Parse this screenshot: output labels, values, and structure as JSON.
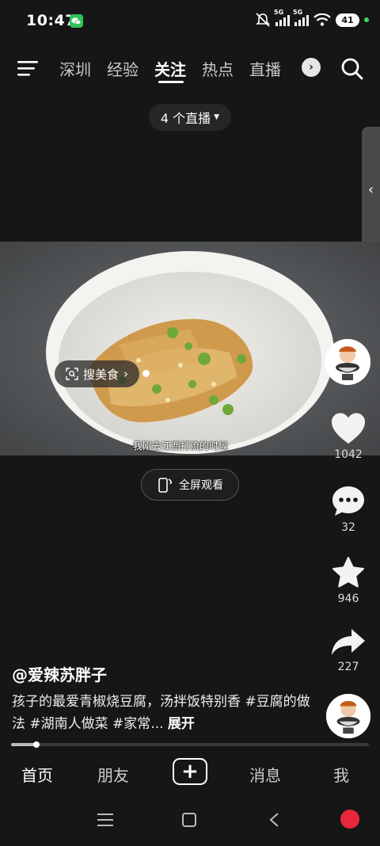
{
  "status_bar": {
    "time": "10:47",
    "signal_1": "5G",
    "signal_2": "5G",
    "battery": "41",
    "icons": [
      "wechat-icon",
      "mute-icon",
      "signal-icon",
      "wifi-icon",
      "battery-icon"
    ]
  },
  "top_nav": {
    "tabs": [
      {
        "label": "深圳",
        "active": false
      },
      {
        "label": "经验",
        "active": false
      },
      {
        "label": "关注",
        "active": true
      },
      {
        "label": "热点",
        "active": false
      },
      {
        "label": "直播",
        "active": false
      }
    ],
    "icons": [
      "menu-icon",
      "chevron-right-icon",
      "search-icon"
    ]
  },
  "live_pill": {
    "label": "4 个直播"
  },
  "video": {
    "search_pill": "搜美食",
    "subtitle": "我刚去江西打流的时候",
    "fullscreen_label": "全屏观看"
  },
  "actions": {
    "likes": "1042",
    "comments": "32",
    "favorites": "946",
    "shares": "227"
  },
  "post": {
    "author": "@爱辣苏胖子",
    "caption": "孩子的最爱青椒烧豆腐，汤拌饭特别香 #豆腐的做法 #湖南人做菜 #家常...",
    "expand": "展开"
  },
  "progress": {
    "fraction": 0.07
  },
  "bottom_tabs": {
    "home": "首页",
    "friends": "朋友",
    "create": "+",
    "messages": "消息",
    "me": "我"
  },
  "colors": {
    "background": "#161616",
    "accent_green": "#2fc45a",
    "record_red": "#e8283a"
  }
}
